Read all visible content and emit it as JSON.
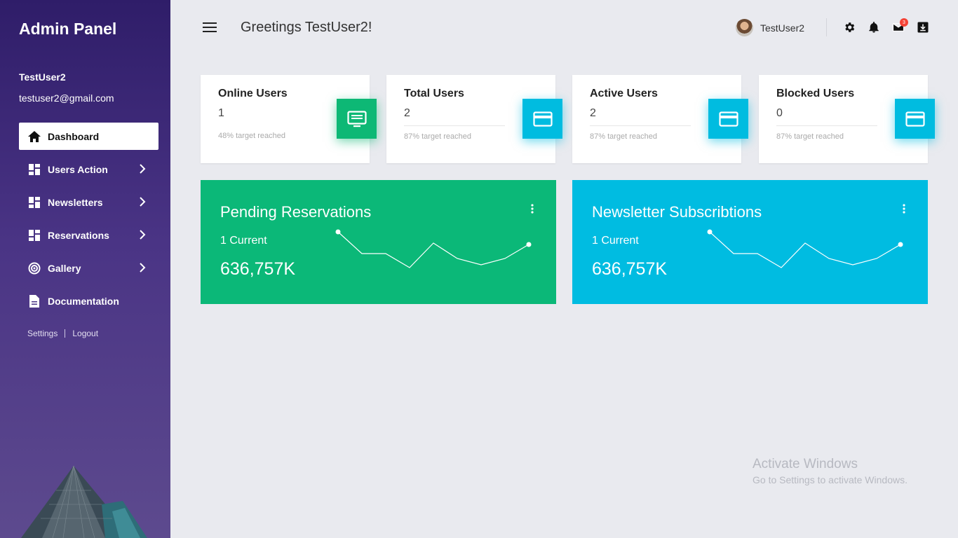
{
  "sidebar": {
    "brand": "Admin Panel",
    "user_name": "TestUser2",
    "user_email": "testuser2@gmail.com",
    "items": [
      {
        "label": "Dashboard",
        "icon": "home-icon",
        "active": true
      },
      {
        "label": "Users Action",
        "icon": "dashboard-grid-icon",
        "expandable": true
      },
      {
        "label": "Newsletters",
        "icon": "dashboard-grid-icon",
        "expandable": true
      },
      {
        "label": "Reservations",
        "icon": "dashboard-grid-icon",
        "expandable": true
      },
      {
        "label": "Gallery",
        "icon": "target-icon",
        "expandable": true
      },
      {
        "label": "Documentation",
        "icon": "document-icon",
        "expandable": false
      }
    ],
    "settings_label": "Settings",
    "logout_label": "Logout"
  },
  "header": {
    "greeting": "Greetings TestUser2!",
    "username": "TestUser2",
    "mail_badge": "3",
    "icons": [
      "settings-gear-icon",
      "notification-bell-icon",
      "mail-icon",
      "download-icon"
    ]
  },
  "stats": [
    {
      "title": "Online Users",
      "value": "1",
      "sub": "48% target reached",
      "icon": "monitor-icon",
      "color": "#0db875"
    },
    {
      "title": "Total Users",
      "value": "2",
      "sub": "87% target reached",
      "icon": "credit-card-icon",
      "color": "#00bce0"
    },
    {
      "title": "Active Users",
      "value": "2",
      "sub": "87% target reached",
      "icon": "credit-card-icon",
      "color": "#00bce0"
    },
    {
      "title": "Blocked Users",
      "value": "0",
      "sub": "87% target reached",
      "icon": "credit-card-icon",
      "color": "#00bce0"
    }
  ],
  "cards": [
    {
      "title": "Pending Reservations",
      "sub": "1 Current",
      "value": "636,757K",
      "color": "#0bb878"
    },
    {
      "title": "Newsletter Subscribtions",
      "sub": "1 Current",
      "value": "636,757K",
      "color": "#00bce1"
    }
  ],
  "watermark": {
    "line1": "Activate Windows",
    "line2": "Go to Settings to activate Windows."
  },
  "colors": {
    "sidebar_top": "#2f1d69",
    "sidebar_bottom": "#5d4a8e",
    "green": "#0bb878",
    "cyan": "#00bce1",
    "background": "#e9eaef"
  }
}
